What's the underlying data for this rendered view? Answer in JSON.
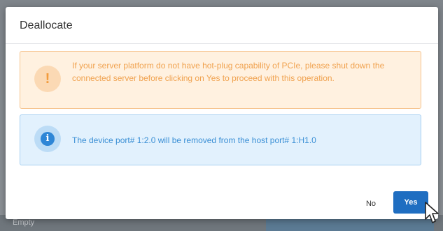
{
  "backdrop": {
    "footer_text": "Empty"
  },
  "dialog": {
    "title": "Deallocate",
    "warning": {
      "icon": "exclamation-icon",
      "icon_glyph": "!",
      "text": "If your server platform do not have hot-plug capability of PCIe, please shut down the connected server before clicking on Yes to proceed with this operation."
    },
    "info": {
      "icon": "info-icon",
      "icon_glyph": "i",
      "text": "The device port# 1:2.0 will be removed from the host port# 1:H1.0"
    },
    "buttons": {
      "no_label": "No",
      "yes_label": "Yes"
    }
  },
  "colors": {
    "primary": "#1f6ec1",
    "warning_text": "#f0a24f",
    "warning_bg": "#fff1e0",
    "info_text": "#3a8fd5",
    "info_bg": "#e2f1fd"
  }
}
